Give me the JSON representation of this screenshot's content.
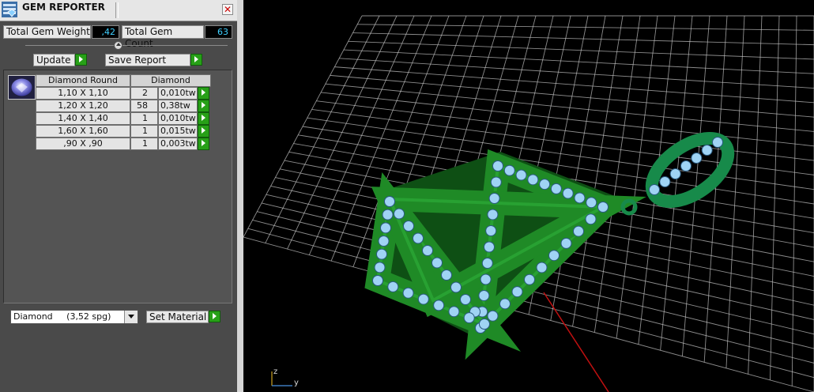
{
  "window": {
    "title": "GEM REPORTER",
    "close_icon": "close-icon",
    "app_icon": "gem-reporter-icon"
  },
  "summary": {
    "total_weight_label": "Total Gem Weight",
    "total_weight_value": ",42",
    "total_count_label": "Total Gem Count",
    "total_count_value": "63"
  },
  "actions": {
    "update_label": "Update",
    "save_report_label": "Save Report"
  },
  "gem_table": {
    "col_shape": "Diamond Round",
    "col_material": "Diamond",
    "rows": [
      {
        "size": "1,10 X 1,10",
        "count": "2",
        "weight": "0,010tw"
      },
      {
        "size": "1,20 X 1,20",
        "count": "58",
        "weight": "0,38tw"
      },
      {
        "size": "1,40 X 1,40",
        "count": "1",
        "weight": "0,010tw"
      },
      {
        "size": "1,60 X 1,60",
        "count": "1",
        "weight": "0,015tw"
      },
      {
        "size": ",90 X ,90",
        "count": "1",
        "weight": "0,003tw"
      }
    ]
  },
  "material": {
    "selected": "Diamond     (3,52 spg)",
    "set_label": "Set Material"
  },
  "viewport": {
    "axis_z": "z",
    "axis_y": "y",
    "colors": {
      "metal": "#1f8a26",
      "gem": "#9fd3f4",
      "grid": "#c8c8c8",
      "axis_x": "#c01010"
    }
  }
}
